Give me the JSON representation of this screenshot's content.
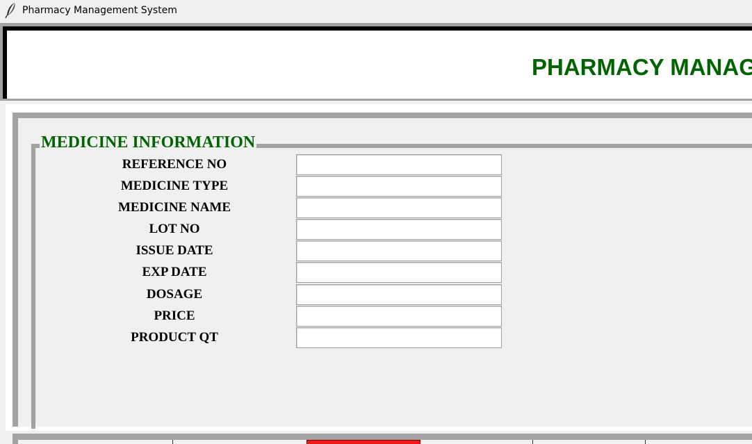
{
  "window": {
    "title": "Pharmacy Management System",
    "icon": "feather-icon"
  },
  "header": {
    "title": "PHARMACY MANAG"
  },
  "medicine_info": {
    "legend": "MEDICINE INFORMATION",
    "fields": [
      {
        "label": "REFERENCE NO",
        "value": ""
      },
      {
        "label": "MEDICINE TYPE",
        "value": ""
      },
      {
        "label": "MEDICINE NAME",
        "value": ""
      },
      {
        "label": "LOT NO",
        "value": ""
      },
      {
        "label": "ISSUE DATE",
        "value": ""
      },
      {
        "label": "EXP DATE",
        "value": ""
      },
      {
        "label": "DOSAGE",
        "value": ""
      },
      {
        "label": "PRICE",
        "value": ""
      },
      {
        "label": "PRODUCT QT",
        "value": ""
      }
    ]
  },
  "colors": {
    "heading_green": "#006400",
    "frame_gray": "#a3a3a3",
    "button_red": "#ee1b1b"
  }
}
